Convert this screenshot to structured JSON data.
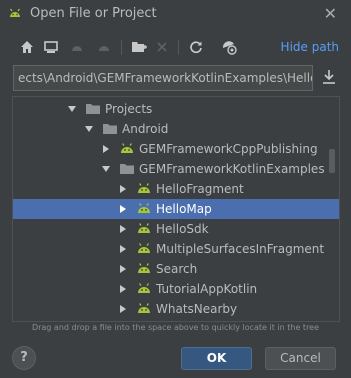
{
  "window": {
    "title": "Open File or Project",
    "close_glyph": "✕"
  },
  "toolbar": {
    "buttons": [
      {
        "name": "home-icon",
        "enabled": true
      },
      {
        "name": "desktop-icon",
        "enabled": true
      },
      {
        "name": "android-project-icon",
        "enabled": false
      },
      {
        "name": "android-module-icon",
        "enabled": false
      },
      {
        "name": "new-folder-icon",
        "enabled": true
      },
      {
        "name": "delete-icon",
        "enabled": false
      },
      {
        "name": "refresh-icon",
        "enabled": true
      },
      {
        "name": "show-hidden-icon",
        "enabled": true
      }
    ],
    "hide_path_label": "Hide path"
  },
  "path": {
    "value": "ects\\Android\\GEMFrameworkKotlinExamples\\HelloMap"
  },
  "tree": {
    "items": [
      {
        "label": "Projects",
        "type": "folder",
        "expanded": true,
        "level": 0
      },
      {
        "label": "Android",
        "type": "folder",
        "expanded": true,
        "level": 1
      },
      {
        "label": "GEMFrameworkCppPublishing",
        "type": "android",
        "expanded": false,
        "level": 2
      },
      {
        "label": "GEMFrameworkKotlinExamples",
        "type": "folder",
        "expanded": true,
        "level": 2
      },
      {
        "label": "HelloFragment",
        "type": "android",
        "expanded": false,
        "level": 3
      },
      {
        "label": "HelloMap",
        "type": "android",
        "expanded": false,
        "level": 3,
        "selected": true
      },
      {
        "label": "HelloSdk",
        "type": "android",
        "expanded": false,
        "level": 3
      },
      {
        "label": "MultipleSurfacesInFragment",
        "type": "android",
        "expanded": false,
        "level": 3
      },
      {
        "label": "Search",
        "type": "android",
        "expanded": false,
        "level": 3
      },
      {
        "label": "TutorialAppKotlin",
        "type": "android",
        "expanded": false,
        "level": 3
      },
      {
        "label": "WhatsNearby",
        "type": "android",
        "expanded": false,
        "level": 3
      }
    ]
  },
  "hint": "Drag and drop a file into the space above to quickly locate it in the tree",
  "buttons": {
    "help": "?",
    "ok": "OK",
    "cancel": "Cancel"
  },
  "colors": {
    "background": "#3c3f41",
    "selection": "#4b6eaf",
    "android_green": "#a4c639",
    "link": "#589df6",
    "ok_button": "#365880"
  }
}
